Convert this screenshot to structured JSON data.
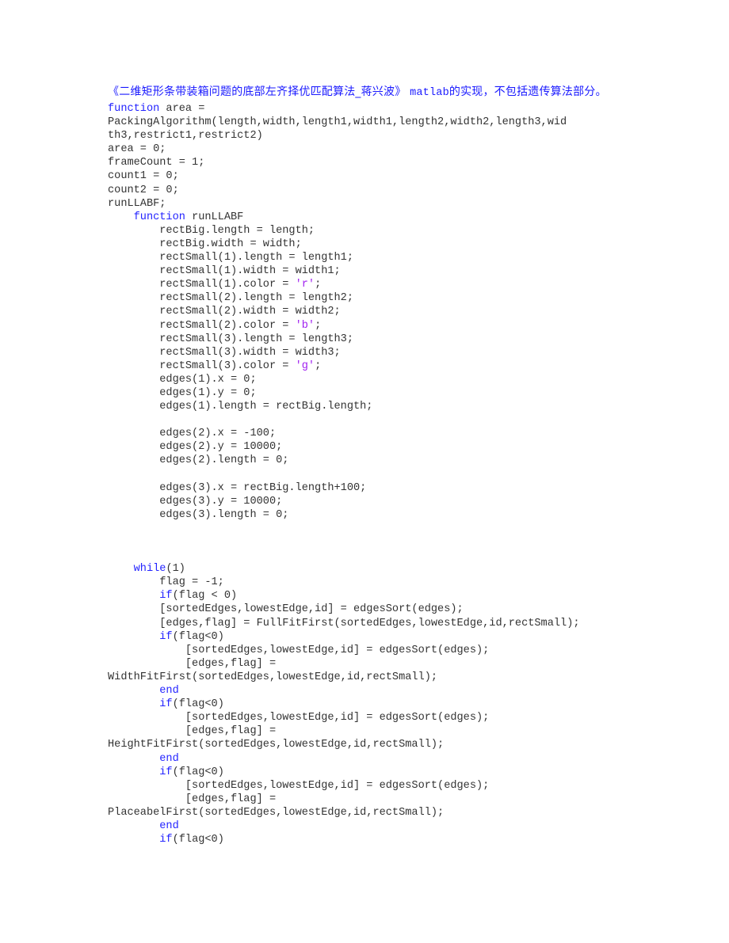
{
  "document": {
    "title_prefix": "《二维矩形条带装箱问题的底部左齐择优匹配算法_蒋兴波》 ",
    "title_mono": "matlab",
    "title_suffix": "的实现，不包括遗传算法部分。",
    "colors": {
      "keyword": "#2424ff",
      "string": "#a020f0",
      "text": "#333333",
      "title": "#1a1aff"
    },
    "code_lines": [
      [
        {
          "t": "function",
          "c": "kw"
        },
        {
          "t": " area ="
        }
      ],
      [
        {
          "t": "PackingAlgorithm(length,width,length1,width1,length2,width2,length3,wid"
        }
      ],
      [
        {
          "t": "th3,restrict1,restrict2)"
        }
      ],
      [
        {
          "t": "area = 0;"
        }
      ],
      [
        {
          "t": "frameCount = 1;"
        }
      ],
      [
        {
          "t": "count1 = 0;"
        }
      ],
      [
        {
          "t": "count2 = 0;"
        }
      ],
      [
        {
          "t": "runLLABF;"
        }
      ],
      [
        {
          "t": "    "
        },
        {
          "t": "function",
          "c": "kw"
        },
        {
          "t": " runLLABF"
        }
      ],
      [
        {
          "t": "        rectBig.length = length;"
        }
      ],
      [
        {
          "t": "        rectBig.width = width;"
        }
      ],
      [
        {
          "t": "        rectSmall(1).length = length1;"
        }
      ],
      [
        {
          "t": "        rectSmall(1).width = width1;"
        }
      ],
      [
        {
          "t": "        rectSmall(1).color = "
        },
        {
          "t": "'r'",
          "c": "str"
        },
        {
          "t": ";"
        }
      ],
      [
        {
          "t": "        rectSmall(2).length = length2;"
        }
      ],
      [
        {
          "t": "        rectSmall(2).width = width2;"
        }
      ],
      [
        {
          "t": "        rectSmall(2).color = "
        },
        {
          "t": "'b'",
          "c": "str"
        },
        {
          "t": ";"
        }
      ],
      [
        {
          "t": "        rectSmall(3).length = length3;"
        }
      ],
      [
        {
          "t": "        rectSmall(3).width = width3;"
        }
      ],
      [
        {
          "t": "        rectSmall(3).color = "
        },
        {
          "t": "'g'",
          "c": "str"
        },
        {
          "t": ";"
        }
      ],
      [
        {
          "t": "        edges(1).x = 0;"
        }
      ],
      [
        {
          "t": "        edges(1).y = 0;"
        }
      ],
      [
        {
          "t": "        edges(1).length = rectBig.length;"
        }
      ],
      [
        {
          "t": ""
        }
      ],
      [
        {
          "t": "        edges(2).x = -100;"
        }
      ],
      [
        {
          "t": "        edges(2).y = 10000;"
        }
      ],
      [
        {
          "t": "        edges(2).length = 0;"
        }
      ],
      [
        {
          "t": ""
        }
      ],
      [
        {
          "t": "        edges(3).x = rectBig.length+100;"
        }
      ],
      [
        {
          "t": "        edges(3).y = 10000;"
        }
      ],
      [
        {
          "t": "        edges(3).length = 0;"
        }
      ],
      [
        {
          "t": ""
        }
      ],
      [
        {
          "t": ""
        }
      ],
      [
        {
          "t": ""
        }
      ],
      [
        {
          "t": "    "
        },
        {
          "t": "while",
          "c": "kw"
        },
        {
          "t": "(1)"
        }
      ],
      [
        {
          "t": "        flag = -1;"
        }
      ],
      [
        {
          "t": "        "
        },
        {
          "t": "if",
          "c": "kw"
        },
        {
          "t": "(flag < 0)"
        }
      ],
      [
        {
          "t": "        [sortedEdges,lowestEdge,id] = edgesSort(edges);"
        }
      ],
      [
        {
          "t": "        [edges,flag] = FullFitFirst(sortedEdges,lowestEdge,id,rectSmall);"
        }
      ],
      [
        {
          "t": "        "
        },
        {
          "t": "if",
          "c": "kw"
        },
        {
          "t": "(flag<0)"
        }
      ],
      [
        {
          "t": "            [sortedEdges,lowestEdge,id] = edgesSort(edges);"
        }
      ],
      [
        {
          "t": "            [edges,flag] ="
        }
      ],
      [
        {
          "t": "WidthFitFirst(sortedEdges,lowestEdge,id,rectSmall);"
        }
      ],
      [
        {
          "t": "        "
        },
        {
          "t": "end",
          "c": "kw"
        }
      ],
      [
        {
          "t": "        "
        },
        {
          "t": "if",
          "c": "kw"
        },
        {
          "t": "(flag<0)"
        }
      ],
      [
        {
          "t": "            [sortedEdges,lowestEdge,id] = edgesSort(edges);"
        }
      ],
      [
        {
          "t": "            [edges,flag] ="
        }
      ],
      [
        {
          "t": "HeightFitFirst(sortedEdges,lowestEdge,id,rectSmall);"
        }
      ],
      [
        {
          "t": "        "
        },
        {
          "t": "end",
          "c": "kw"
        }
      ],
      [
        {
          "t": "        "
        },
        {
          "t": "if",
          "c": "kw"
        },
        {
          "t": "(flag<0)"
        }
      ],
      [
        {
          "t": "            [sortedEdges,lowestEdge,id] = edgesSort(edges);"
        }
      ],
      [
        {
          "t": "            [edges,flag] ="
        }
      ],
      [
        {
          "t": "PlaceabelFirst(sortedEdges,lowestEdge,id,rectSmall);"
        }
      ],
      [
        {
          "t": "        "
        },
        {
          "t": "end",
          "c": "kw"
        }
      ],
      [
        {
          "t": "        "
        },
        {
          "t": "if",
          "c": "kw"
        },
        {
          "t": "(flag<0)"
        }
      ]
    ]
  }
}
